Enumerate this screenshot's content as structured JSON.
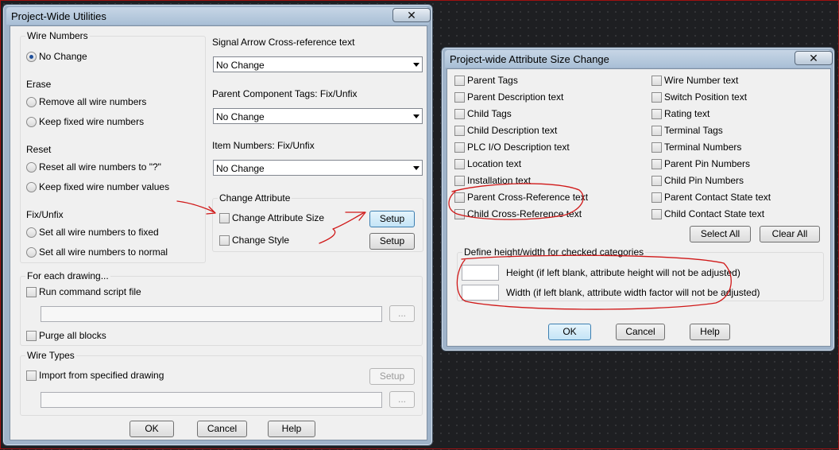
{
  "dialog1": {
    "title": "Project-Wide Utilities",
    "close": "✕",
    "wire_numbers": {
      "legend": "Wire Numbers",
      "no_change": "No Change",
      "erase_label": "Erase",
      "remove_all": "Remove all wire numbers",
      "keep_fixed": "Keep fixed wire numbers",
      "reset_label": "Reset",
      "reset_all": "Reset all wire numbers to \"?\"",
      "keep_fixed_values": "Keep fixed wire number values",
      "fixunfix_label": "Fix/Unfix",
      "set_fixed": "Set all wire numbers to fixed",
      "set_normal": "Set all wire numbers to normal"
    },
    "signal_arrow": {
      "label": "Signal Arrow Cross-reference text",
      "value": "No Change"
    },
    "parent_tags": {
      "label": "Parent Component Tags: Fix/Unfix",
      "value": "No Change"
    },
    "item_numbers": {
      "label": "Item Numbers: Fix/Unfix",
      "value": "No Change"
    },
    "change_attribute": {
      "legend": "Change Attribute",
      "size_label": "Change Attribute Size",
      "style_label": "Change Style",
      "setup1": "Setup",
      "setup2": "Setup"
    },
    "each_drawing": {
      "legend": "For each drawing...",
      "run_script": "Run command script file",
      "browse": "...",
      "purge": "Purge all blocks"
    },
    "wire_types": {
      "legend": "Wire Types",
      "import": "Import from specified drawing",
      "setup": "Setup",
      "browse": "..."
    },
    "buttons": {
      "ok": "OK",
      "cancel": "Cancel",
      "help": "Help"
    }
  },
  "dialog2": {
    "title": "Project-wide Attribute Size Change",
    "close": "✕",
    "left_items": [
      "Parent Tags",
      "Parent Description text",
      "Child Tags",
      "Child Description text",
      "PLC I/O Description text",
      "Location text",
      "Installation text",
      "Parent Cross-Reference text",
      "Child Cross-Reference text"
    ],
    "right_items": [
      "Wire Number text",
      "Switch Position text",
      "Rating text",
      "Terminal Tags",
      "Terminal Numbers",
      "Parent Pin Numbers",
      "Child Pin Numbers",
      "Parent Contact State text",
      "Child Contact State text"
    ],
    "select_all": "Select All",
    "clear_all": "Clear All",
    "define": {
      "legend": "Define height/width for checked categories",
      "height_label": "Height (if left blank, attribute height will not be adjusted)",
      "width_label": "Width (if left blank, attribute width factor will not be adjusted)",
      "height_value": "",
      "width_value": ""
    },
    "buttons": {
      "ok": "OK",
      "cancel": "Cancel",
      "help": "Help"
    }
  },
  "colors": {
    "annotation": "#d01818",
    "title_bar": "#a9bfd6",
    "background": "#1e1f22"
  }
}
